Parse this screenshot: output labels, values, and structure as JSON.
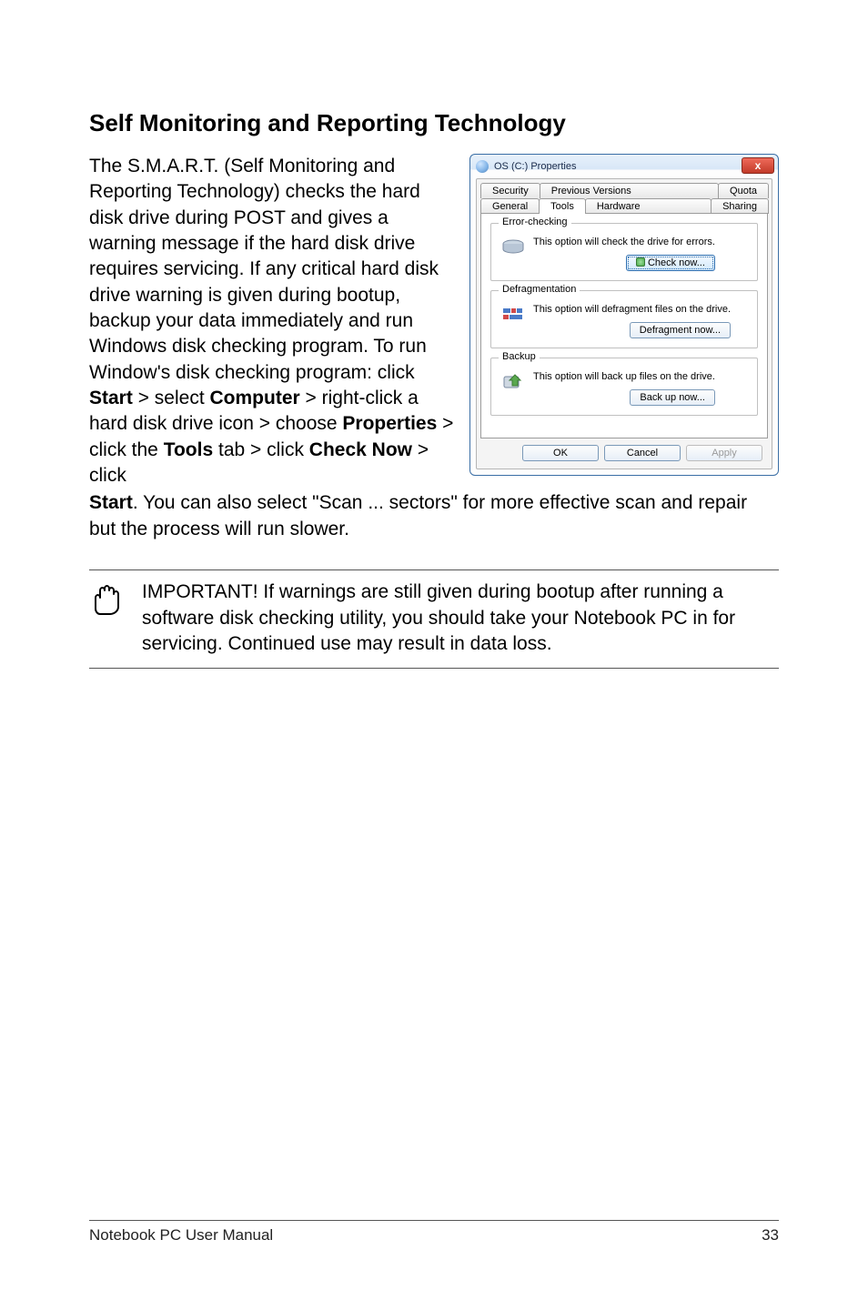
{
  "heading": "Self Monitoring and Reporting Technology",
  "body_pre": "The S.M.A.R.T. (Self Monitoring and Reporting Technology) checks the hard disk drive during POST and gives a warning message if the hard disk drive requires servicing. If any critical hard disk drive warning is given during bootup, backup your data immediately and run Windows disk checking program. To run Window's disk checking program: click ",
  "b1": "Start",
  "mid1": " > select ",
  "b2": "Computer",
  "mid2": " > right-click a hard disk drive icon > choose ",
  "b3": "Properties",
  "mid3": " > click the ",
  "b4": "Tools",
  "mid4": " tab > click ",
  "b5": "Check Now",
  "mid5": " > click ",
  "b6": "Start",
  "post": ". You can also select \"Scan ... sectors\" for more effective scan and repair but the process will run slower.",
  "important": "IMPORTANT! If warnings are still given during bootup after running a software disk checking utility, you should take your Notebook PC in for servicing. Continued use may result in data loss.",
  "footer_left": "Notebook PC User Manual",
  "footer_right": "33",
  "dialog": {
    "title": "OS (C:) Properties",
    "close": "x",
    "tabs_top": [
      "Security",
      "Previous Versions",
      "Quota"
    ],
    "tabs_bot": [
      "General",
      "Tools",
      "Hardware",
      "Sharing"
    ],
    "active_tab": "Tools",
    "groups": {
      "error": {
        "title": "Error-checking",
        "text": "This option will check the drive for errors.",
        "button": "Check now..."
      },
      "defrag": {
        "title": "Defragmentation",
        "text": "This option will defragment files on the drive.",
        "button": "Defragment now..."
      },
      "backup": {
        "title": "Backup",
        "text": "This option will back up files on the drive.",
        "button": "Back up now..."
      }
    },
    "ok": "OK",
    "cancel": "Cancel",
    "apply": "Apply"
  }
}
